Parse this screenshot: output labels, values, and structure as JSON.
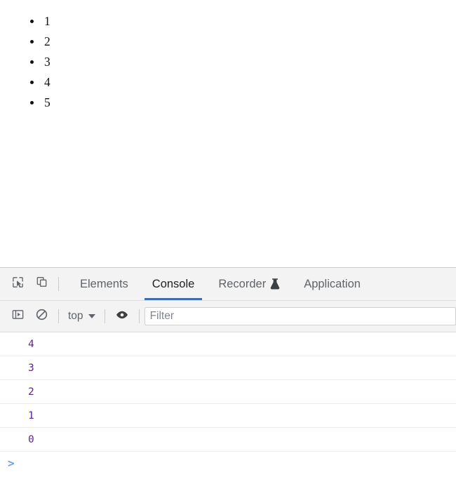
{
  "page": {
    "list_items": [
      "1",
      "2",
      "3",
      "4",
      "5"
    ]
  },
  "devtools": {
    "toolbar_left": [
      {
        "name": "inspect-element-icon",
        "label": "Inspect element"
      },
      {
        "name": "device-toolbar-icon",
        "label": "Toggle device toolbar"
      }
    ],
    "tabs": [
      {
        "label": "Elements",
        "active": false,
        "icon": null
      },
      {
        "label": "Console",
        "active": true,
        "icon": null
      },
      {
        "label": "Recorder",
        "active": false,
        "icon": "flask-icon"
      },
      {
        "label": "Application",
        "active": false,
        "icon": null
      }
    ],
    "console_toolbar": {
      "sidebar_toggle": "Show console sidebar",
      "clear_console": "Clear console",
      "context_label": "top",
      "eye_label": "Create live expression",
      "filter_placeholder": "Filter",
      "filter_value": ""
    },
    "console_messages": [
      {
        "text": "4"
      },
      {
        "text": "3"
      },
      {
        "text": "2"
      },
      {
        "text": "1"
      },
      {
        "text": "0"
      }
    ],
    "prompt_symbol": ">"
  },
  "colors": {
    "accent": "#1a73e8",
    "number_literal": "#5a1fa8",
    "prompt": "#6d9eeb",
    "toolbar_bg": "#f3f3f3"
  }
}
